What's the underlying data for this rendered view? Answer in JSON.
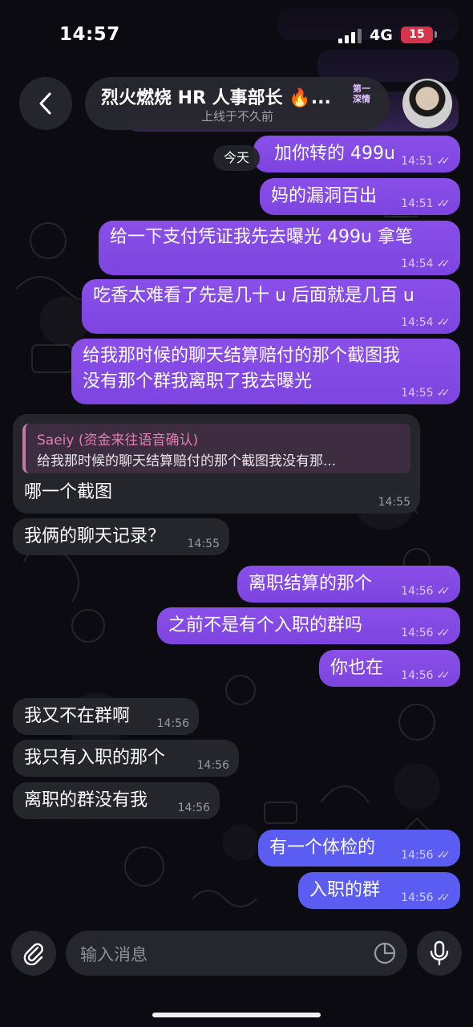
{
  "status_bar": {
    "time": "14:57",
    "network": "4G",
    "battery": "15"
  },
  "header": {
    "title": "烈火燃烧 HR 人事部长 🔥...",
    "badge": "第一深情",
    "subtitle": "上线于不久前"
  },
  "day_chip": "今天",
  "messages": [
    {
      "dir": "out",
      "text": "加你转的 499u",
      "time": "14:51"
    },
    {
      "dir": "out",
      "text": "妈的漏洞百出",
      "time": "14:51"
    },
    {
      "dir": "out",
      "text": "给一下支付凭证我先去曝光 499u 拿笔",
      "time": "14:54"
    },
    {
      "dir": "out",
      "text": "吃香太难看了先是几十 u 后面就是几百 u",
      "time": "14:54"
    },
    {
      "dir": "out",
      "text_line1": "给我那时候的聊天结算赔付的那个截图我",
      "text_line2": "没有那个群我离职了我去曝光",
      "time": "14:55"
    },
    {
      "dir": "in",
      "reply_name": "Saeiy (资金来往语音确认)",
      "reply_text": "给我那时候的聊天结算赔付的那个截图我没有那...",
      "text": "哪一个截图",
      "time": "14:55"
    },
    {
      "dir": "in",
      "text": "我俩的聊天记录？",
      "time": "14:55"
    },
    {
      "dir": "out",
      "text": "离职结算的那个",
      "time": "14:56"
    },
    {
      "dir": "out",
      "text": "之前不是有个入职的群吗",
      "time": "14:56"
    },
    {
      "dir": "out",
      "text": "你也在",
      "time": "14:56"
    },
    {
      "dir": "in",
      "text": "我又不在群啊",
      "time": "14:56"
    },
    {
      "dir": "in",
      "text": "我只有入职的那个",
      "time": "14:56"
    },
    {
      "dir": "in",
      "text": "离职的群没有我",
      "time": "14:56"
    },
    {
      "dir": "out",
      "text": "有一个体检的",
      "time": "14:56"
    },
    {
      "dir": "out",
      "text": "入职的群",
      "time": "14:56"
    }
  ],
  "input": {
    "placeholder": "输入消息"
  },
  "icons": {
    "back": "chevron-left-icon",
    "attach": "paperclip-icon",
    "sticker": "sticker-icon",
    "mic": "microphone-icon"
  },
  "colors": {
    "outgoing": "#8a4fe8",
    "outgoing_blue": "#5b5cf2",
    "incoming": "#26262e",
    "battery": "#d6344b"
  }
}
